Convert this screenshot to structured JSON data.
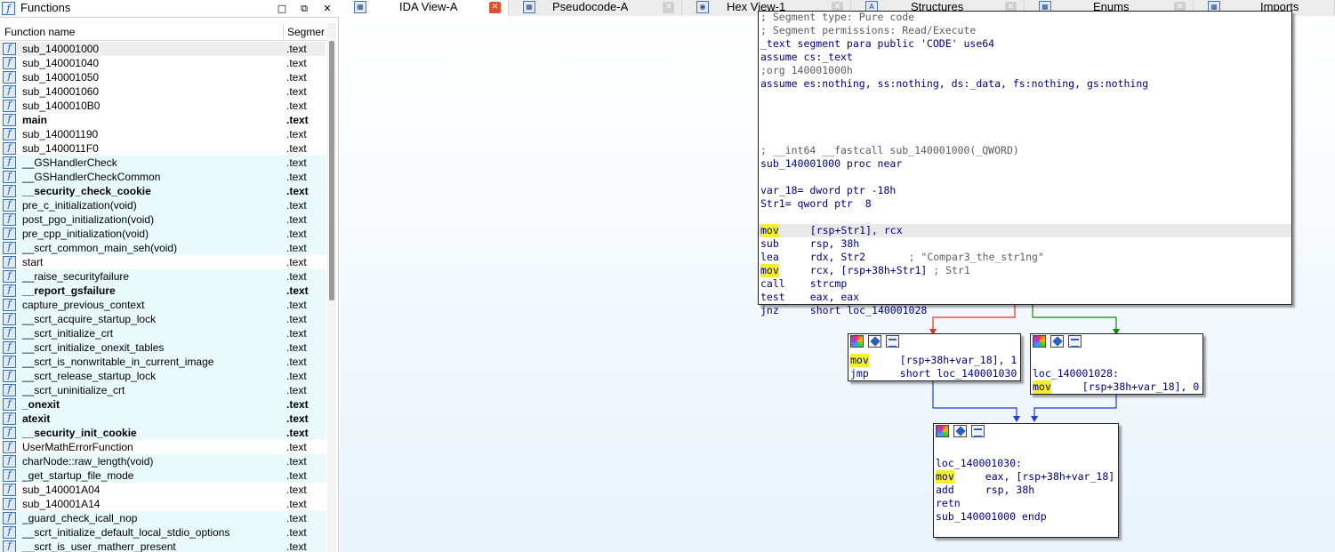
{
  "functions_panel": {
    "title": "Functions",
    "columns": {
      "name": "Function name",
      "segment": "Segmer"
    },
    "rows": [
      {
        "name": "sub_140001000",
        "seg": ".text",
        "bold": false
      },
      {
        "name": "sub_140001040",
        "seg": ".text",
        "bold": false
      },
      {
        "name": "sub_140001050",
        "seg": ".text",
        "bold": false
      },
      {
        "name": "sub_140001060",
        "seg": ".text",
        "bold": false
      },
      {
        "name": "sub_1400010B0",
        "seg": ".text",
        "bold": false
      },
      {
        "name": "main",
        "seg": ".text",
        "bold": true
      },
      {
        "name": "sub_140001190",
        "seg": ".text",
        "bold": false
      },
      {
        "name": "sub_1400011F0",
        "seg": ".text",
        "bold": false
      },
      {
        "name": "__GSHandlerCheck",
        "seg": ".text",
        "bold": false
      },
      {
        "name": "__GSHandlerCheckCommon",
        "seg": ".text",
        "bold": false
      },
      {
        "name": "__security_check_cookie",
        "seg": ".text",
        "bold": true
      },
      {
        "name": "pre_c_initialization(void)",
        "seg": ".text",
        "bold": false
      },
      {
        "name": "post_pgo_initialization(void)",
        "seg": ".text",
        "bold": false
      },
      {
        "name": "pre_cpp_initialization(void)",
        "seg": ".text",
        "bold": false
      },
      {
        "name": "__scrt_common_main_seh(void)",
        "seg": ".text",
        "bold": false
      },
      {
        "name": "start",
        "seg": ".text",
        "bold": false
      },
      {
        "name": "__raise_securityfailure",
        "seg": ".text",
        "bold": false
      },
      {
        "name": "__report_gsfailure",
        "seg": ".text",
        "bold": true
      },
      {
        "name": "capture_previous_context",
        "seg": ".text",
        "bold": false
      },
      {
        "name": "__scrt_acquire_startup_lock",
        "seg": ".text",
        "bold": false
      },
      {
        "name": "__scrt_initialize_crt",
        "seg": ".text",
        "bold": false
      },
      {
        "name": "__scrt_initialize_onexit_tables",
        "seg": ".text",
        "bold": false
      },
      {
        "name": "__scrt_is_nonwritable_in_current_image",
        "seg": ".text",
        "bold": false
      },
      {
        "name": "__scrt_release_startup_lock",
        "seg": ".text",
        "bold": false
      },
      {
        "name": "__scrt_uninitialize_crt",
        "seg": ".text",
        "bold": false
      },
      {
        "name": "_onexit",
        "seg": ".text",
        "bold": true
      },
      {
        "name": "atexit",
        "seg": ".text",
        "bold": true
      },
      {
        "name": "__security_init_cookie",
        "seg": ".text",
        "bold": true
      },
      {
        "name": "UserMathErrorFunction",
        "seg": ".text",
        "bold": false
      },
      {
        "name": "charNode::raw_length(void)",
        "seg": ".text",
        "bold": false
      },
      {
        "name": "_get_startup_file_mode",
        "seg": ".text",
        "bold": false
      },
      {
        "name": "sub_140001A04",
        "seg": ".text",
        "bold": false
      },
      {
        "name": "sub_140001A14",
        "seg": ".text",
        "bold": false
      },
      {
        "name": "_guard_check_icall_nop",
        "seg": ".text",
        "bold": false
      },
      {
        "name": "__scrt_initialize_default_local_stdio_options",
        "seg": ".text",
        "bold": false
      },
      {
        "name": "__scrt_is_user_matherr_present",
        "seg": ".text",
        "bold": false
      }
    ],
    "row_colors": {
      "normal": "#ffffff",
      "library": "#e9fafd",
      "selected": "#eeeeee"
    }
  },
  "tabs": [
    {
      "label": "IDA View-A",
      "active": true,
      "icon": "ida-view-icon"
    },
    {
      "label": "Pseudocode-A",
      "active": false,
      "icon": "pseudocode-icon"
    },
    {
      "label": "Hex View-1",
      "active": false,
      "icon": "hex-view-icon"
    },
    {
      "label": "Structures",
      "active": false,
      "icon": "structures-icon"
    },
    {
      "label": "Enums",
      "active": false,
      "icon": "enums-icon"
    },
    {
      "label": "Imports",
      "active": false,
      "icon": "imports-icon"
    }
  ],
  "graph": {
    "main_block": [
      {
        "t": "; Segment type: Pure code",
        "c": "cmt"
      },
      {
        "t": "; Segment permissions: Read/Execute",
        "c": "cmt"
      },
      {
        "t": "_text segment para public 'CODE' use64",
        "c": ""
      },
      {
        "t": "assume cs:_text",
        "c": ""
      },
      {
        "t": ";org 140001000h",
        "c": "cmt"
      },
      {
        "t": "assume es:nothing, ss:nothing, ds:_data, fs:nothing, gs:nothing",
        "c": ""
      },
      {
        "t": "",
        "c": "gap"
      },
      {
        "t": "",
        "c": "gap"
      },
      {
        "t": "",
        "c": "gap"
      },
      {
        "t": "",
        "c": "gap"
      },
      {
        "t": "; __int64 __fastcall sub_140001000(_QWORD)",
        "c": "cmt"
      },
      {
        "t": "sub_140001000 proc near",
        "c": ""
      },
      {
        "t": "",
        "c": "gap"
      },
      {
        "t": "var_18= dword ptr -18h",
        "c": ""
      },
      {
        "t": "Str1= qword ptr  8",
        "c": ""
      },
      {
        "t": "",
        "c": "gap"
      }
    ],
    "main_insns": [
      {
        "m": "mov",
        "y": true,
        "ops": "[rsp+Str1], rcx",
        "cmt": "",
        "hl": true
      },
      {
        "m": "sub",
        "y": false,
        "ops": "rsp, 38h",
        "cmt": "",
        "hl": false
      },
      {
        "m": "lea",
        "y": false,
        "ops": "rdx, Str2       ",
        "cmt": "; \"Compar3_the_str1ng\"",
        "hl": false
      },
      {
        "m": "mov",
        "y": true,
        "ops": "rcx, [rsp+38h+Str1] ",
        "cmt": "; Str1",
        "hl": false
      },
      {
        "m": "call",
        "y": false,
        "ops": "strcmp",
        "cmt": "",
        "hl": false
      },
      {
        "m": "test",
        "y": false,
        "ops": "eax, eax",
        "cmt": "",
        "hl": false
      },
      {
        "m": "jnz",
        "y": false,
        "ops": "short loc_140001028",
        "cmt": "",
        "hl": false
      }
    ],
    "left_block": [
      {
        "m": "mov",
        "y": true,
        "ops": "[rsp+38h+var_18], 1"
      },
      {
        "m": "jmp",
        "y": false,
        "ops": "short loc_140001030"
      }
    ],
    "right_block": {
      "label": "loc_140001028:",
      "insns": [
        {
          "m": "mov",
          "y": true,
          "ops": "[rsp+38h+var_18], 0"
        }
      ]
    },
    "bottom_block": {
      "label": "loc_140001030:",
      "insns": [
        {
          "m": "mov",
          "y": true,
          "ops": "eax, [rsp+38h+var_18]"
        },
        {
          "m": "add",
          "y": false,
          "ops": "rsp, 38h"
        },
        {
          "m": "retn",
          "y": false,
          "ops": ""
        }
      ],
      "endp": "sub_140001000 endp"
    },
    "edge_colors": {
      "false": "#e03030",
      "true": "#108a10",
      "uncond": "#1f3fd6"
    }
  }
}
